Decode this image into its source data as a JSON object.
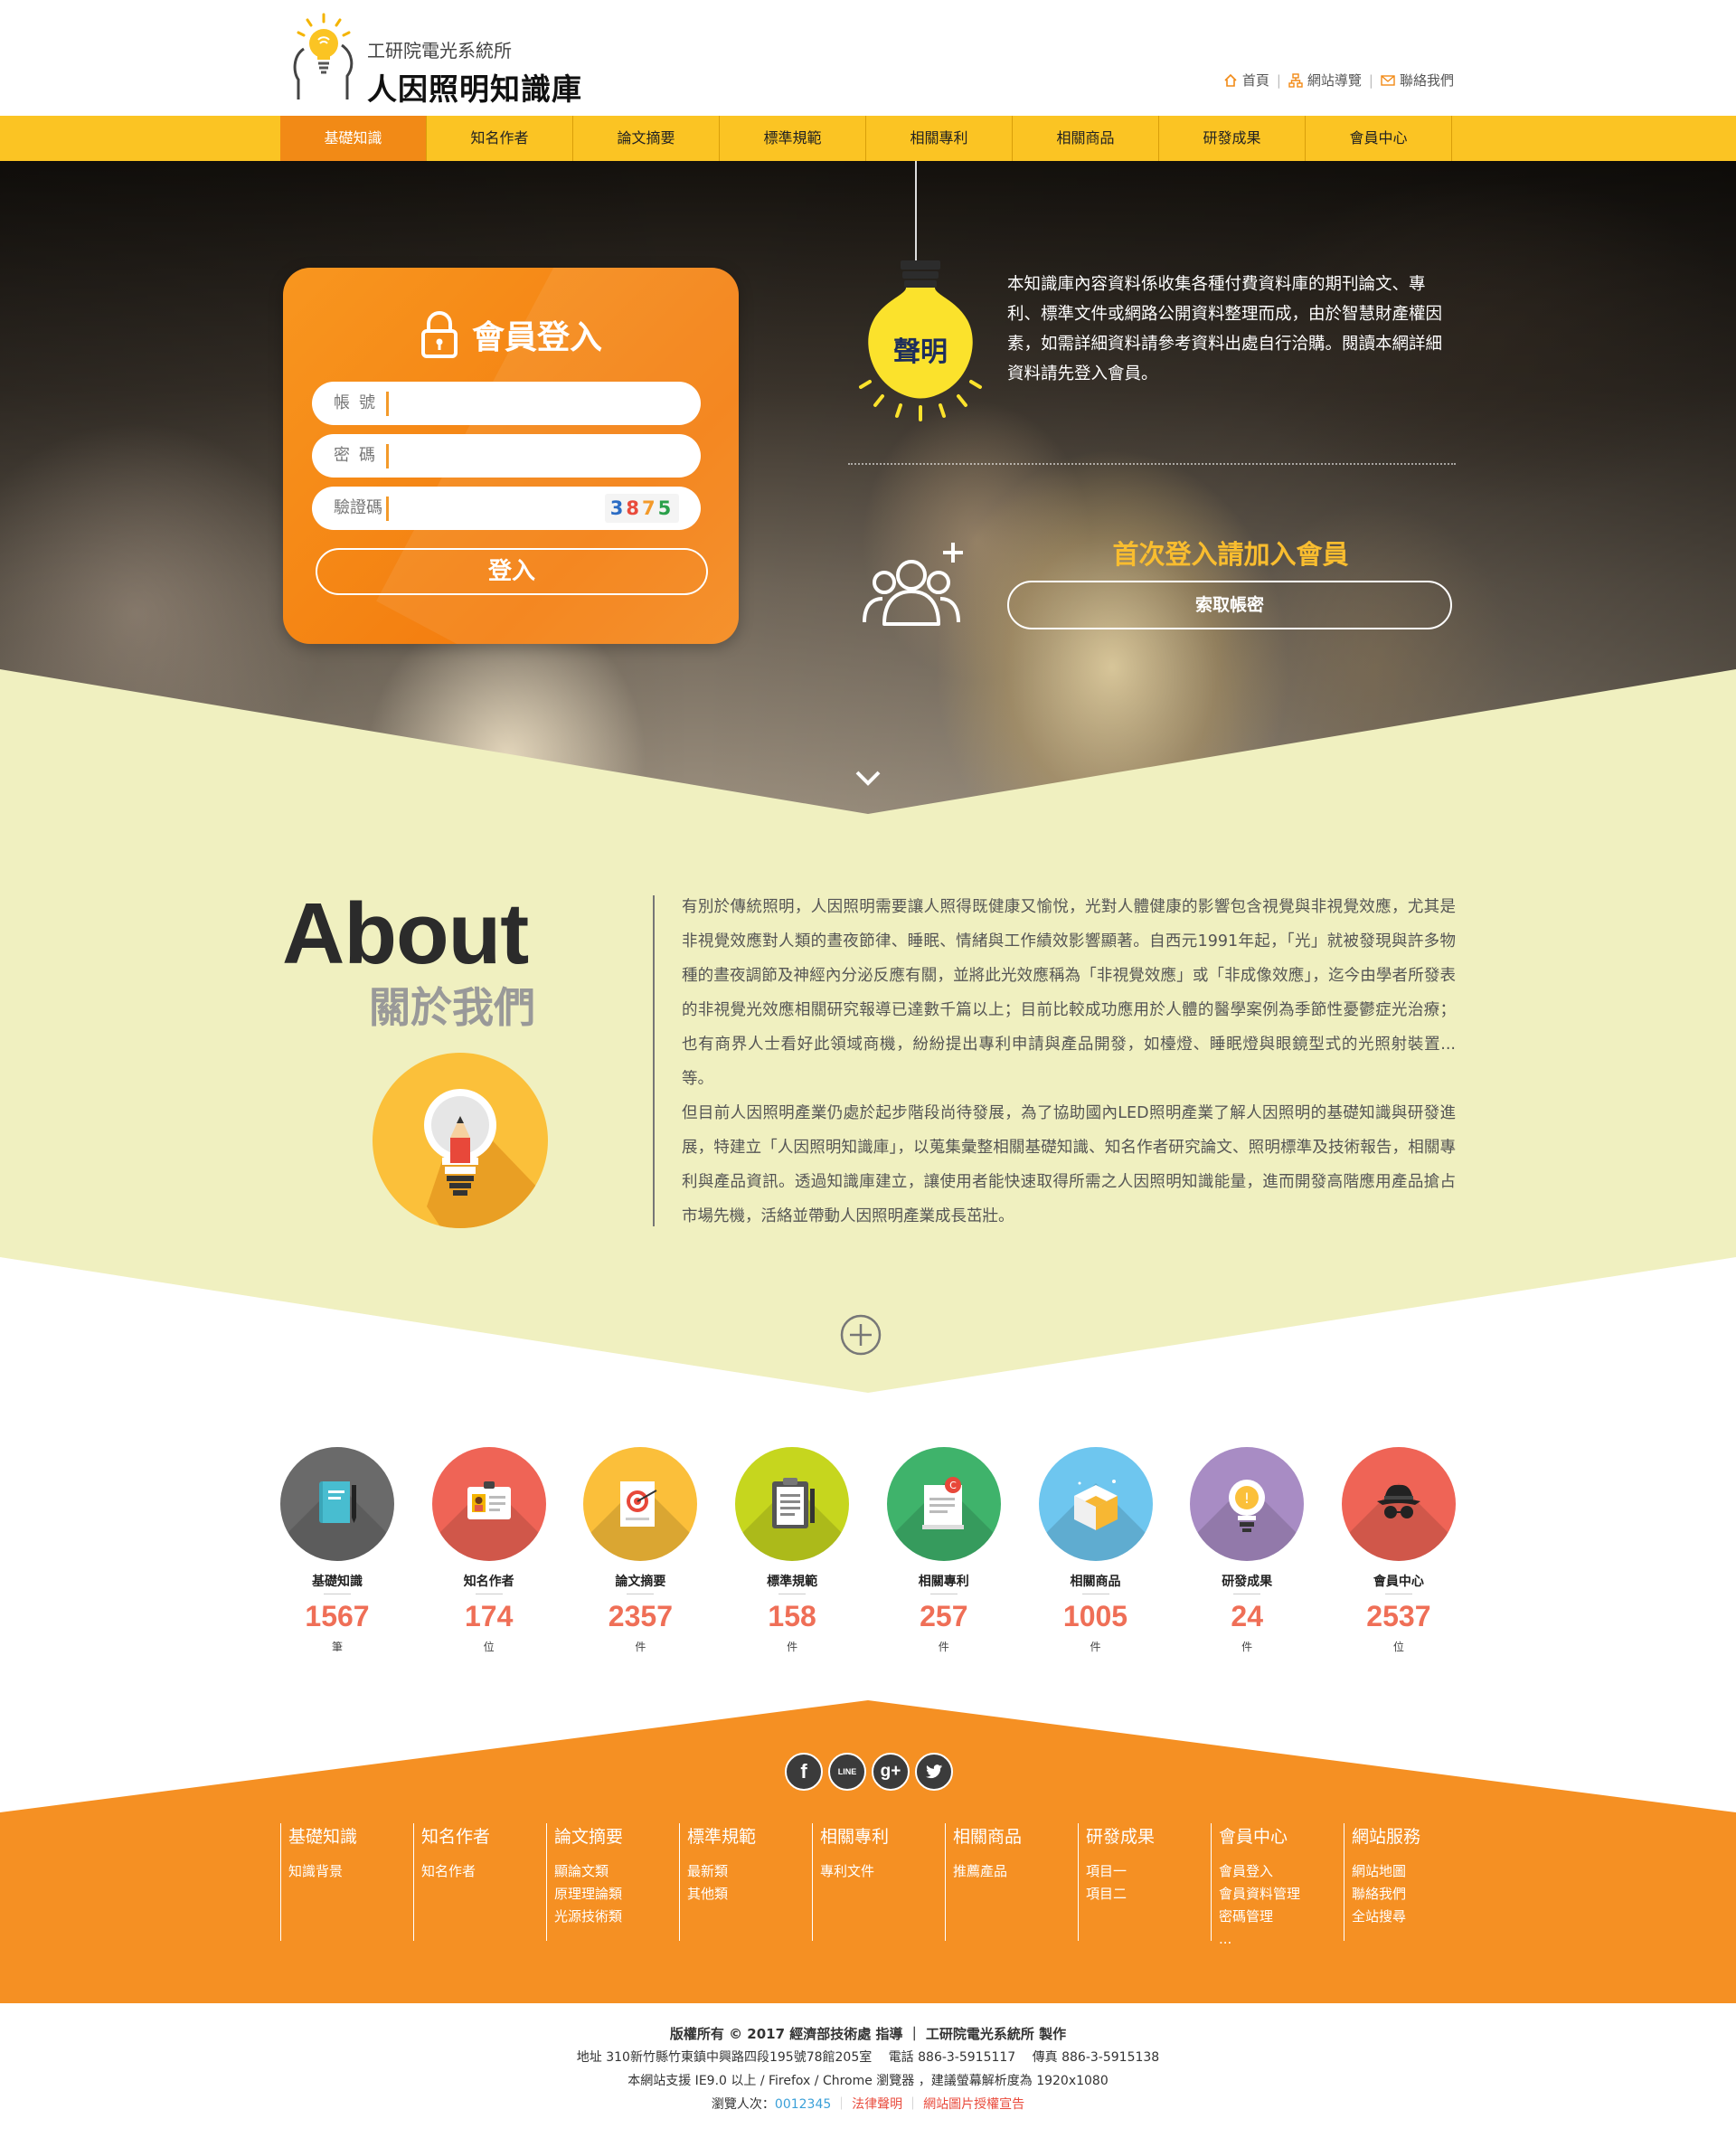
{
  "header": {
    "org": "工研院電光系統所",
    "site_title": "人因照明知識庫",
    "top_links": [
      "首頁",
      "網站導覽",
      "聯絡我們"
    ]
  },
  "nav": [
    "基礎知識",
    "知名作者",
    "論文摘要",
    "標準規範",
    "相關專利",
    "相關商品",
    "研發成果",
    "會員中心"
  ],
  "login": {
    "title": "會員登入",
    "account_label": "帳號",
    "password_label": "密碼",
    "captcha_label": "驗證碼",
    "captcha_digits": [
      "3",
      "8",
      "7",
      "5"
    ],
    "captcha_colors": [
      "#2b6cc4",
      "#e94b3c",
      "#f39a2a",
      "#2aa04a"
    ],
    "button": "登入"
  },
  "notice": {
    "badge": "聲明",
    "text": "本知識庫內容資料係收集各種付費資料庫的期刊論文、專利、標準文件或網路公開資料整理而成，由於智慧財產權因素，如需詳細資料請參考資料出處自行洽購。閱讀本網詳細資料請先登入會員。"
  },
  "join": {
    "title": "首次登入請加入會員",
    "recover_button": "索取帳密"
  },
  "about": {
    "title_en": "About",
    "title_zh": "關於我們",
    "paragraphs": [
      "有別於傳統照明，人因照明需要讓人照得既健康又愉悅，光對人體健康的影響包含視覺與非視覺效應，尤其是非視覺效應對人類的晝夜節律、睡眠、情緒與工作績效影響顯著。自西元1991年起，「光」就被發現與許多物種的晝夜調節及神經內分泌反應有關，並將此光效應稱為「非視覺效應」或「非成像效應」，迄今由學者所發表的非視覺光效應相關研究報導已達數千篇以上；目前比較成功應用於人體的醫學案例為季節性憂鬱症光治療；也有商界人士看好此領域商機，紛紛提出專利申請與產品開發，如檯燈、睡眠燈與眼鏡型式的光照射裝置...等。",
      "但目前人因照明產業仍處於起步階段尚待發展，為了協助國內LED照明產業了解人因照明的基礎知識與研發進展，特建立「人因照明知識庫」，以蒐集彙整相關基礎知識、知名作者研究論文、照明標準及技術報告，相關專利與產品資訊。透過知識庫建立，讓使用者能快速取得所需之人因照明知識能量，進而開發高階應用產品搶占市場先機，活絡並帶動人因照明產業成長茁壯。"
    ]
  },
  "stats": [
    {
      "label": "基礎知識",
      "count": "1567",
      "unit": "筆",
      "color": "#6a6a6a",
      "icon": "notebook-icon"
    },
    {
      "label": "知名作者",
      "count": "174",
      "unit": "位",
      "color": "#ef6456",
      "icon": "id-badge-icon"
    },
    {
      "label": "論文摘要",
      "count": "2357",
      "unit": "件",
      "color": "#fbbf3a",
      "icon": "target-document-icon"
    },
    {
      "label": "標準規範",
      "count": "158",
      "unit": "件",
      "color": "#c6d61e",
      "icon": "clipboard-icon"
    },
    {
      "label": "相關專利",
      "count": "257",
      "unit": "件",
      "color": "#3fb36b",
      "icon": "patent-document-icon"
    },
    {
      "label": "相關商品",
      "count": "1005",
      "unit": "件",
      "color": "#6ec6ef",
      "icon": "product-box-icon"
    },
    {
      "label": "研發成果",
      "count": "24",
      "unit": "件",
      "color": "#a88cc4",
      "icon": "lightbulb-icon"
    },
    {
      "label": "會員中心",
      "count": "2537",
      "unit": "位",
      "color": "#ef6456",
      "icon": "spy-hat-icon"
    }
  ],
  "social": [
    "f",
    "LINE",
    "g+",
    "twitter"
  ],
  "footer_nav": [
    {
      "title": "基礎知識",
      "items": [
        "知識背景"
      ]
    },
    {
      "title": "知名作者",
      "items": [
        "知名作者"
      ]
    },
    {
      "title": "論文摘要",
      "items": [
        "顯論文類",
        "原理理論類",
        "光源技術類"
      ]
    },
    {
      "title": "標準規範",
      "items": [
        "最新類",
        "其他類"
      ]
    },
    {
      "title": "相關專利",
      "items": [
        "專利文件"
      ]
    },
    {
      "title": "相關商品",
      "items": [
        "推薦產品"
      ]
    },
    {
      "title": "研發成果",
      "items": [
        "項目一",
        "項目二"
      ]
    },
    {
      "title": "會員中心",
      "items": [
        "會員登入",
        "會員資料管理",
        "密碼管理",
        "..."
      ]
    },
    {
      "title": "網站服務",
      "items": [
        "網站地圖",
        "聯絡我們",
        "全站搜尋"
      ]
    }
  ],
  "copyright": {
    "line1": "版權所有 © 2017 經濟部技術處 指導 ｜ 工研院電光系統所 製作",
    "line2": "地址 310新竹縣竹東鎮中興路四段195號78館205室 　電話 886-3-5915117 　傳真 886-3-5915138",
    "line3": "本網站支援 IE9.0 以上 / Firefox / Chrome 瀏覽器 ，建議螢幕解析度為 1920x1080",
    "visitors_label": "瀏覽人次：",
    "visitors": "0012345",
    "legal": "法律聲明",
    "image_credit": "網站圖片授權宣告"
  },
  "colors": {
    "nav_yellow": "#fbc423",
    "accent_orange": "#f28a16",
    "about_bg": "#f0f0c0",
    "footer_orange": "#f59023"
  }
}
